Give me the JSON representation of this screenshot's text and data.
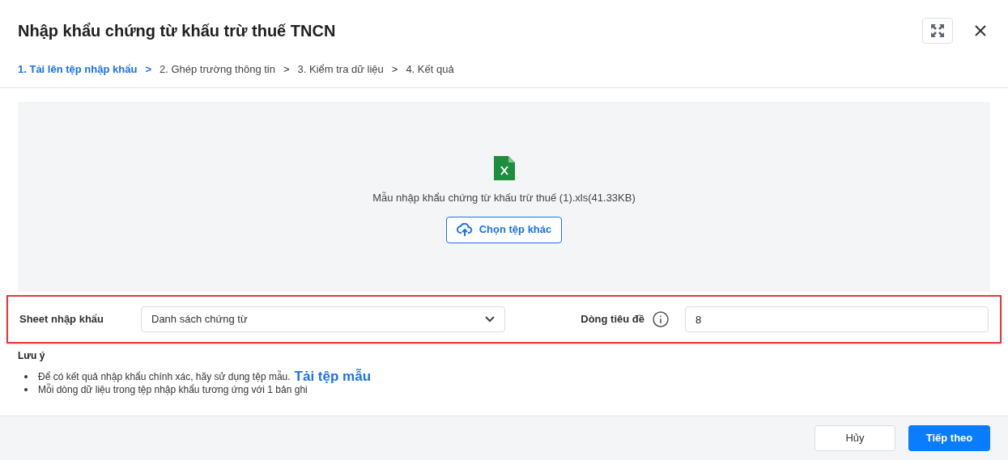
{
  "dialog": {
    "title": "Nhập khẩu chứng từ khấu trừ thuế TNCN"
  },
  "steps": [
    {
      "label": "1. Tải lên tệp nhập khẩu",
      "selected": true
    },
    {
      "label": "2. Ghép trường thông tin",
      "selected": false
    },
    {
      "label": "3. Kiểm tra dữ liệu",
      "selected": false
    },
    {
      "label": "4. Kết quả",
      "selected": false
    }
  ],
  "step_separator": ">",
  "upload": {
    "file_name": "Mẫu nhập khẩu chứng từ khấu trừ thuế (1).xls(41.33KB)",
    "button": "Chọn tệp khác"
  },
  "settings": {
    "highlighted": true,
    "sheet_label": "Sheet nhập khẩu",
    "sheet_value": "Danh sách chứng từ",
    "header_row_label": "Dòng tiêu đề",
    "header_row_value": "8"
  },
  "notes": {
    "title": "Lưu ý",
    "items": [
      {
        "text": "Để có kết quả nhập khẩu chính xác, hãy sử dụng tệp mẫu.",
        "link": "Tải tệp mẫu"
      },
      {
        "text": "Mỗi dòng dữ liệu trong tệp nhập khẩu tương ứng với 1 bản ghi"
      }
    ]
  },
  "buttons": {
    "cancel": "Hủy",
    "next": "Tiếp theo"
  }
}
